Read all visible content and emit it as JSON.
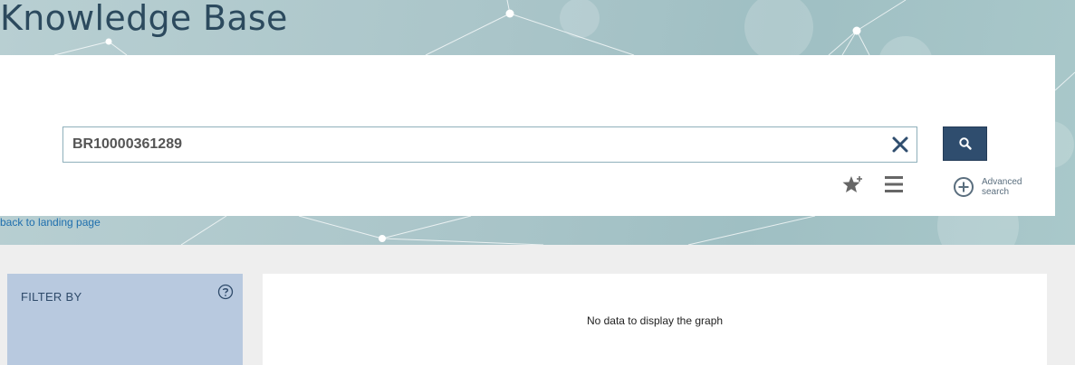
{
  "header": {
    "title": "Knowledge Base"
  },
  "search": {
    "query": "BR10000361289",
    "clear_icon": "close-icon",
    "submit_icon": "search-icon",
    "favorite_icon": "star-plus-icon",
    "menu_icon": "hamburger-menu-icon",
    "advanced_icon": "circle-plus-icon",
    "advanced_label": "Advanced search"
  },
  "nav": {
    "back_link": "back to landing page"
  },
  "filter": {
    "title": "FILTER BY",
    "help_icon": "help-icon"
  },
  "graph": {
    "empty_message": "No data to display the graph"
  },
  "colors": {
    "title": "#2c4a5e",
    "search_button": "#2f4d6e",
    "filter_panel": "#b8c9df",
    "link": "#1f6fae"
  }
}
